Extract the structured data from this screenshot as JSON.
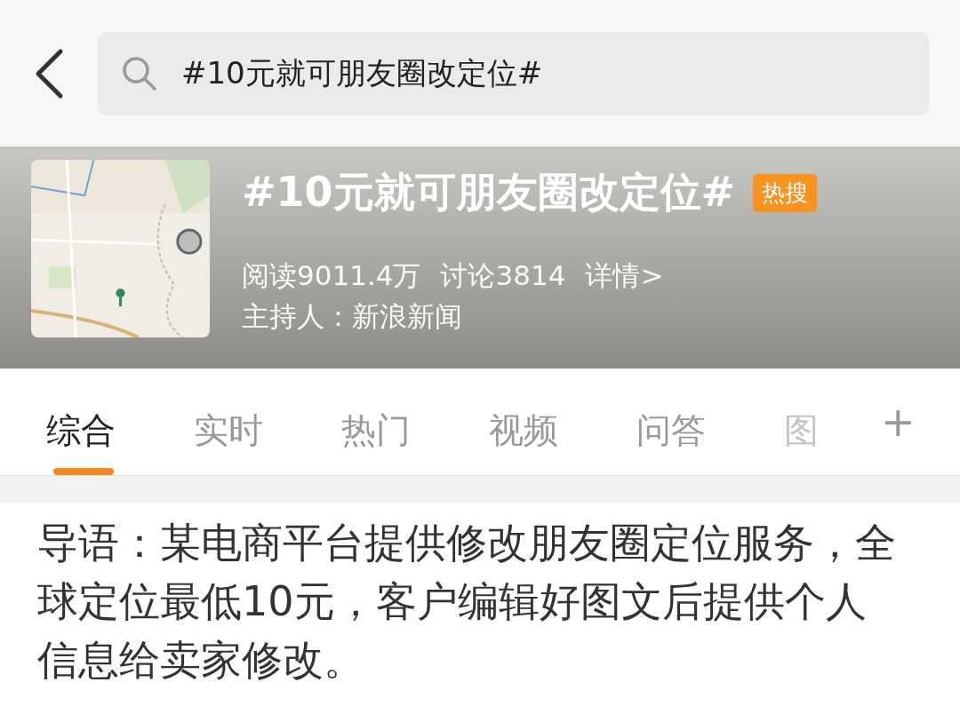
{
  "search": {
    "value": "#10元就可朋友圈改定位#"
  },
  "topic": {
    "title": "#10元就可朋友圈改定位#",
    "badge": "热搜",
    "reads": "阅读9011.4万",
    "discussions": "讨论3814",
    "details": "详情>",
    "host": "主持人：新浪新闻"
  },
  "tabs": [
    {
      "label": "综合",
      "selected": true
    },
    {
      "label": "实时",
      "selected": false
    },
    {
      "label": "热门",
      "selected": false
    },
    {
      "label": "视频",
      "selected": false
    },
    {
      "label": "问答",
      "selected": false
    },
    {
      "label": "图",
      "selected": false
    }
  ],
  "add_tab": "+",
  "intro": "导语：某电商平台提供修改朋友圈定位服务，全球定位最低10元，客户编辑好图文后提供个人信息给卖家修改。"
}
